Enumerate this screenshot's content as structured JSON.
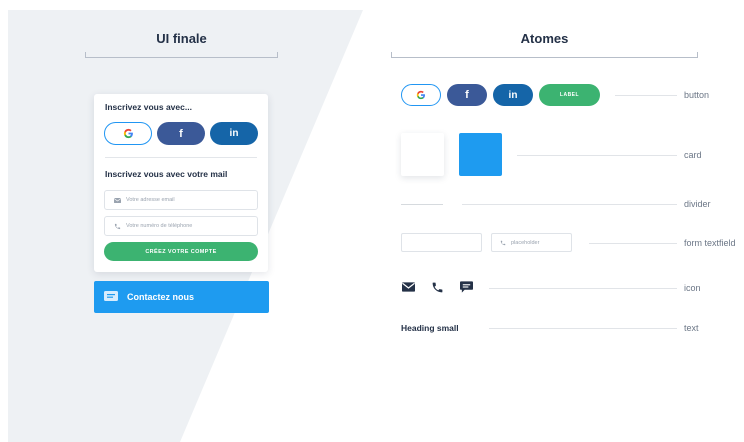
{
  "sections": {
    "left_title": "UI finale",
    "right_title": "Atomes"
  },
  "card": {
    "heading_social": "Inscrivez vous avec...",
    "social": {
      "google": "G",
      "facebook": "f",
      "linkedin": "in"
    },
    "heading_mail": "Inscrivez vous avec votre mail",
    "email_placeholder": "Votre adresse email",
    "phone_placeholder": "Votre numéro de téléphone",
    "create_button": "CRÉEZ VOTRE COMPTE"
  },
  "contact_button": "Contactez nous",
  "atoms": {
    "buttons": {
      "google": "G",
      "facebook": "f",
      "linkedin": "in",
      "label": "LABEL"
    },
    "textfield_placeholder": "placeholder",
    "heading_small": "Heading small",
    "names": {
      "button": "button",
      "card": "card",
      "divider": "divider",
      "form_textfield": "form textfield",
      "icon": "icon",
      "text": "text"
    }
  },
  "icons": [
    "google-icon",
    "facebook-icon",
    "linkedin-icon",
    "mail-icon",
    "phone-icon",
    "chat-icon"
  ],
  "colors": {
    "background_panel": "#eef1f4",
    "accent_blue": "#1e9bf0",
    "green": "#3cb371",
    "facebook": "#3b5998",
    "linkedin": "#1565a8"
  }
}
